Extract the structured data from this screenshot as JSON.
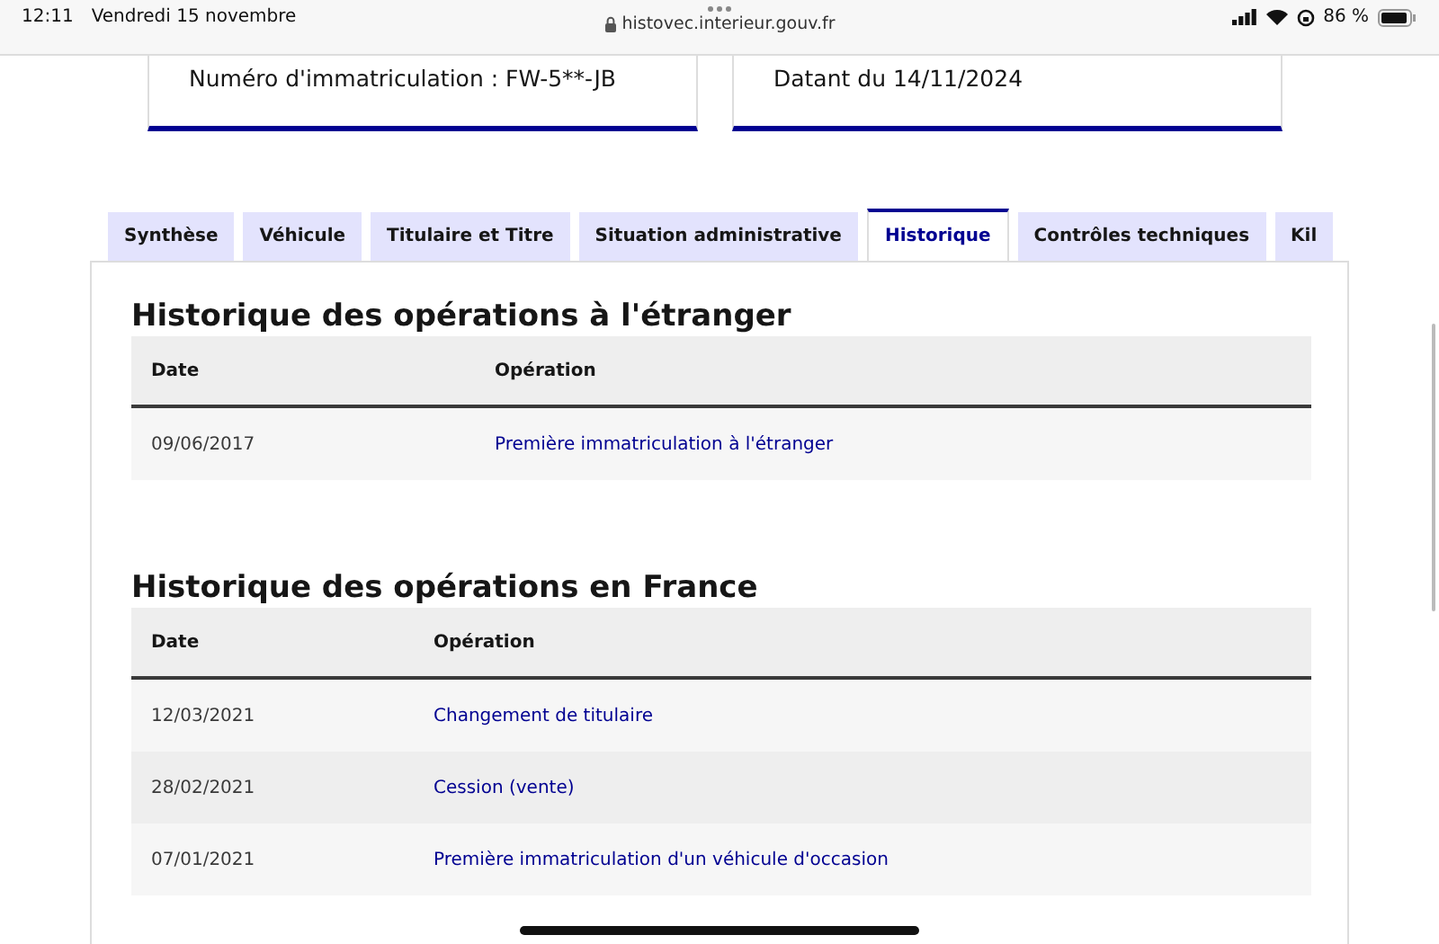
{
  "status_bar": {
    "time": "12:11",
    "date": "Vendredi 15 novembre",
    "url": "histovec.interieur.gouv.fr",
    "battery": "86 %"
  },
  "cards": [
    {
      "text": "Numéro d'immatriculation : FW-5**-JB"
    },
    {
      "text": "Datant du 14/11/2024"
    }
  ],
  "tabs": [
    {
      "label": "Synthèse",
      "selected": false
    },
    {
      "label": "Véhicule",
      "selected": false
    },
    {
      "label": "Titulaire et Titre",
      "selected": false
    },
    {
      "label": "Situation administrative",
      "selected": false
    },
    {
      "label": "Historique",
      "selected": true
    },
    {
      "label": "Contrôles techniques",
      "selected": false
    },
    {
      "label": "Kil",
      "selected": false
    }
  ],
  "sections": [
    {
      "title": "Historique des opérations à l'étranger",
      "columns": [
        "Date",
        "Opération"
      ],
      "rows": [
        {
          "date": "09/06/2017",
          "operation": "Première immatriculation à l'étranger"
        }
      ]
    },
    {
      "title": "Historique des opérations en France",
      "columns": [
        "Date",
        "Opération"
      ],
      "rows": [
        {
          "date": "12/03/2021",
          "operation": "Changement de titulaire"
        },
        {
          "date": "28/02/2021",
          "operation": "Cession (vente)"
        },
        {
          "date": "07/01/2021",
          "operation": "Première immatriculation d'un véhicule d'occasion"
        }
      ]
    }
  ]
}
